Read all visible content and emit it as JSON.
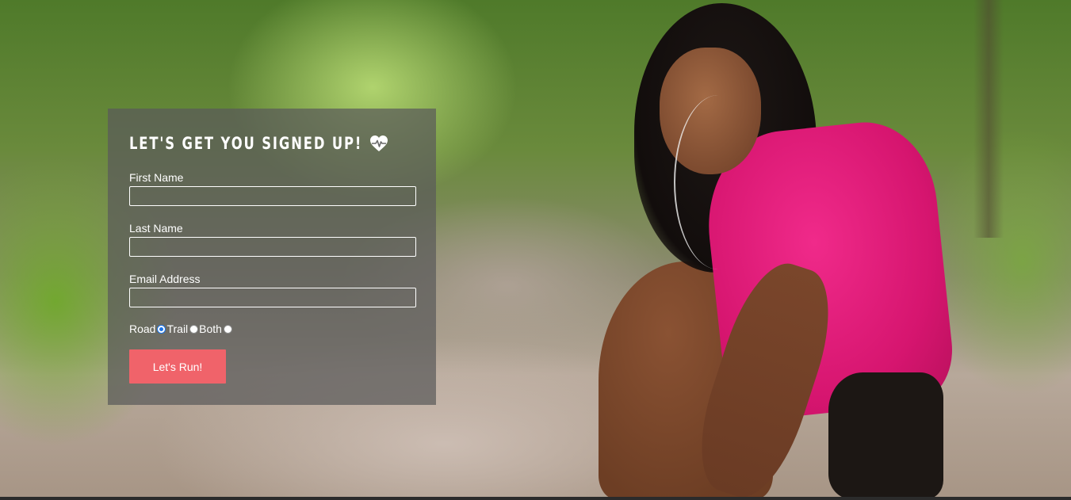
{
  "signup": {
    "title": "LET'S GET YOU SIGNED UP!",
    "title_icon": "heartbeat-icon",
    "fields": [
      {
        "label": "First Name",
        "value": "",
        "placeholder": ""
      },
      {
        "label": "Last Name",
        "value": "",
        "placeholder": ""
      },
      {
        "label": "Email Address",
        "value": "",
        "placeholder": ""
      }
    ],
    "run_type": {
      "options": [
        {
          "label": "Road",
          "checked": true
        },
        {
          "label": "Trail",
          "checked": false
        },
        {
          "label": "Both",
          "checked": false
        }
      ]
    },
    "submit_label": "Let's Run!"
  },
  "colors": {
    "panel_background": "#5a5a5a",
    "button_background": "#f0636a",
    "text": "#ffffff",
    "radio_selected": "#1a73e8"
  }
}
